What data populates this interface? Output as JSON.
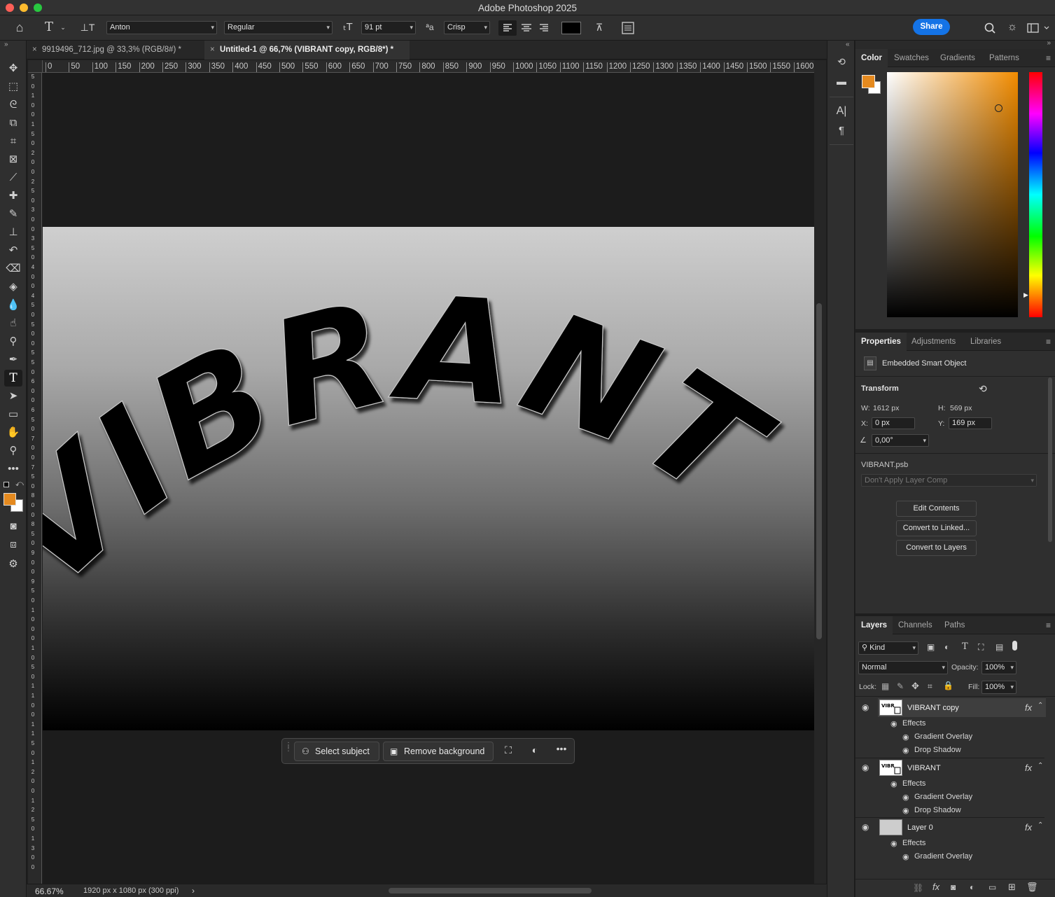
{
  "app": {
    "title": "Adobe Photoshop 2025"
  },
  "options_bar": {
    "font_family": "Anton",
    "font_style": "Regular",
    "font_size": "91 pt",
    "antialias": "Crisp",
    "share_label": "Share"
  },
  "tabs": [
    {
      "label": "9919496_712.jpg @ 33,3% (RGB/8#) *",
      "active": false
    },
    {
      "label": "Untitled-1 @ 66,7% (VIBRANT copy, RGB/8*) *",
      "active": true
    }
  ],
  "ruler": {
    "h": [
      "0",
      "50",
      "100",
      "150",
      "200",
      "250",
      "300",
      "350",
      "400",
      "450",
      "500",
      "550",
      "600",
      "650",
      "700",
      "750",
      "800",
      "850",
      "900",
      "950",
      "1000",
      "1050",
      "1100",
      "1150",
      "1200",
      "1250",
      "1300",
      "1350",
      "1400",
      "1450",
      "1500",
      "1550",
      "1600"
    ],
    "v": [
      "5",
      "0",
      "1",
      "0",
      "0",
      "1",
      "5",
      "0",
      "2",
      "0",
      "0",
      "2",
      "5",
      "0",
      "3",
      "0",
      "0",
      "3",
      "5",
      "0",
      "4",
      "0",
      "0",
      "4",
      "5",
      "0",
      "5",
      "0",
      "0",
      "5",
      "5",
      "0",
      "6",
      "0",
      "0",
      "6",
      "5",
      "0",
      "7",
      "0",
      "0",
      "7",
      "5",
      "0",
      "8",
      "0",
      "0",
      "8",
      "5",
      "0",
      "9",
      "0",
      "0",
      "9",
      "5",
      "0",
      "1",
      "0",
      "0",
      "0",
      "1",
      "0",
      "5",
      "0",
      "1",
      "1",
      "0",
      "0",
      "1",
      "1",
      "5",
      "0",
      "1",
      "2",
      "0",
      "0",
      "1",
      "2",
      "5",
      "0",
      "1",
      "3",
      "0",
      "0"
    ]
  },
  "canvas": {
    "text": "VIBRANT"
  },
  "taskbar": {
    "select_subject": "Select subject",
    "remove_background": "Remove background"
  },
  "status": {
    "zoom": "66.67%",
    "doc_info": "1920 px x 1080 px (300 ppi)"
  },
  "color_panel": {
    "tabs": [
      "Color",
      "Swatches",
      "Gradients",
      "Patterns"
    ],
    "foreground": "#e58a1f",
    "background": "#ffffff"
  },
  "properties": {
    "tabs": [
      "Properties",
      "Adjustments",
      "Libraries"
    ],
    "kind": "Embedded Smart Object",
    "section": "Transform",
    "w_label": "W:",
    "w": "1612 px",
    "h_label": "H:",
    "h": "569 px",
    "x_label": "X:",
    "x": "0 px",
    "y_label": "Y:",
    "y": "169 px",
    "angle": "0,00°",
    "file": "VIBRANT.psb",
    "layer_comp": "Don't Apply Layer Comp",
    "edit_contents": "Edit Contents",
    "convert_linked": "Convert to Linked...",
    "convert_layers": "Convert to Layers"
  },
  "layers_panel": {
    "tabs": [
      "Layers",
      "Channels",
      "Paths"
    ],
    "kind_filter": "Kind",
    "blend_mode": "Normal",
    "opacity_label": "Opacity:",
    "opacity": "100%",
    "lock_label": "Lock:",
    "fill_label": "Fill:",
    "fill": "100%",
    "effects_label": "Effects",
    "layers": [
      {
        "name": "VIBRANT copy",
        "effects": [
          "Gradient Overlay",
          "Drop Shadow"
        ]
      },
      {
        "name": "VIBRANT",
        "effects": [
          "Gradient Overlay",
          "Drop Shadow"
        ]
      },
      {
        "name": "Layer 0",
        "effects": [
          "Gradient Overlay"
        ]
      }
    ]
  }
}
